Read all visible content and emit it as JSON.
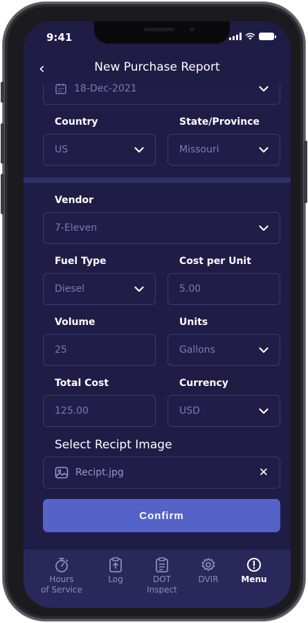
{
  "status_bar": {
    "time": "9:41"
  },
  "header": {
    "back_symbol": "‹",
    "title": "New Purchase Report"
  },
  "form": {
    "date_value": "18-Dec-2021",
    "country": {
      "label": "Country",
      "value": "US"
    },
    "state": {
      "label": "State/Province",
      "value": "Missouri"
    },
    "vendor": {
      "label": "Vendor",
      "value": "7-Eleven"
    },
    "fuel_type": {
      "label": "Fuel Type",
      "value": "Diesel"
    },
    "cost_per_unit": {
      "label": "Cost per Unit",
      "value": "5.00"
    },
    "volume": {
      "label": "Volume",
      "value": "25"
    },
    "units": {
      "label": "Units",
      "value": "Gallons"
    },
    "total_cost": {
      "label": "Total Cost",
      "value": "125.00"
    },
    "currency": {
      "label": "Currency",
      "value": "USD"
    },
    "receipt": {
      "label": "Select Recipt Image",
      "file_name": "Recipt.jpg",
      "clear_symbol": "✕"
    },
    "confirm_label": "Confirm"
  },
  "tabbar": {
    "items": [
      {
        "label_line1": "Hours",
        "label_line2": "of Service",
        "icon": "stopwatch-icon"
      },
      {
        "label_line1": "Log",
        "label_line2": "",
        "icon": "clipboard-upload-icon"
      },
      {
        "label_line1": "DOT",
        "label_line2": "Inspect",
        "icon": "clipboard-list-icon"
      },
      {
        "label_line1": "DVIR",
        "label_line2": "",
        "icon": "gear-icon"
      },
      {
        "label_line1": "Menu",
        "label_line2": "",
        "icon": "info-icon",
        "active": true
      }
    ]
  },
  "colors": {
    "background": "#1f1c46",
    "field_border": "#3d3a72",
    "accent_button": "#5562c7",
    "tabbar": "#2a285a",
    "divider": "#2e2f6b"
  }
}
